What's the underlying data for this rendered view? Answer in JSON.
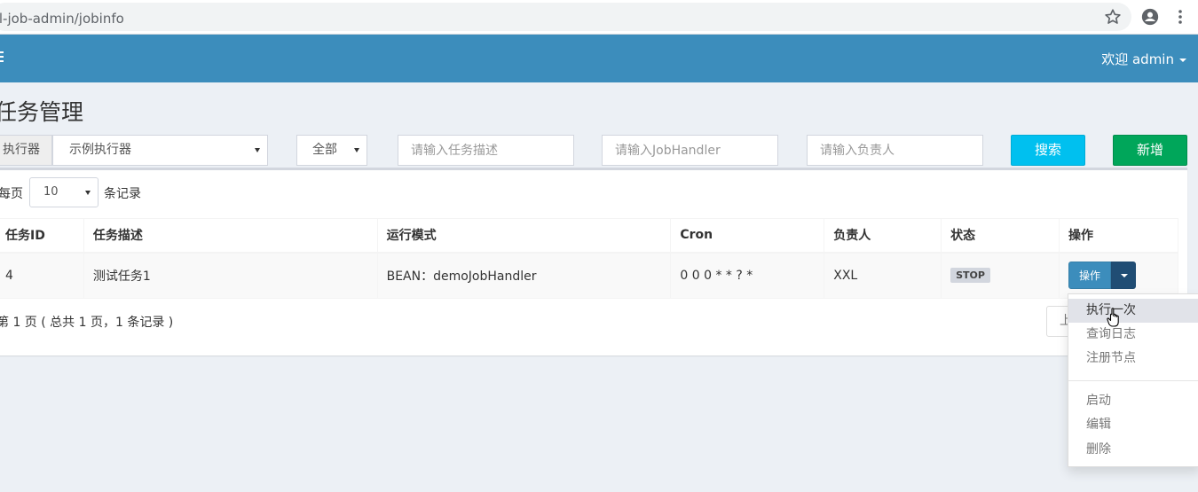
{
  "browser": {
    "url": "xl-job-admin/jobinfo"
  },
  "header": {
    "user_greeting": "欢迎 admin"
  },
  "page": {
    "title": "任务管理"
  },
  "filters": {
    "executor_label": "执行器",
    "executor_value": "示例执行器",
    "status_value": "全部",
    "desc_placeholder": "请输入任务描述",
    "handler_placeholder": "请输入JobHandler",
    "author_placeholder": "请输入负责人",
    "search_label": "搜索",
    "add_label": "新增"
  },
  "table_len": {
    "prefix": "每页",
    "value": "10",
    "suffix": "条记录"
  },
  "table": {
    "columns": [
      "任务ID",
      "任务描述",
      "运行模式",
      "Cron",
      "负责人",
      "状态",
      "操作"
    ],
    "rows": [
      {
        "id": "4",
        "desc": "测试任务1",
        "mode": "BEAN：demoJobHandler",
        "cron": "0 0 0 * * ? *",
        "author": "XXL",
        "status": "STOP",
        "op": "操作"
      }
    ]
  },
  "pagination": {
    "info": "第 1 页 ( 总共 1 页，1 条记录 )",
    "prev": "上"
  },
  "dropdown": {
    "items": [
      "执行一次",
      "查询日志",
      "注册节点",
      "启动",
      "编辑",
      "删除"
    ]
  },
  "colors": {
    "header_bg": "#3c8dbc",
    "search_btn": "#00c0ef",
    "add_btn": "#00a65a",
    "op_btn": "#3c8dbc"
  }
}
